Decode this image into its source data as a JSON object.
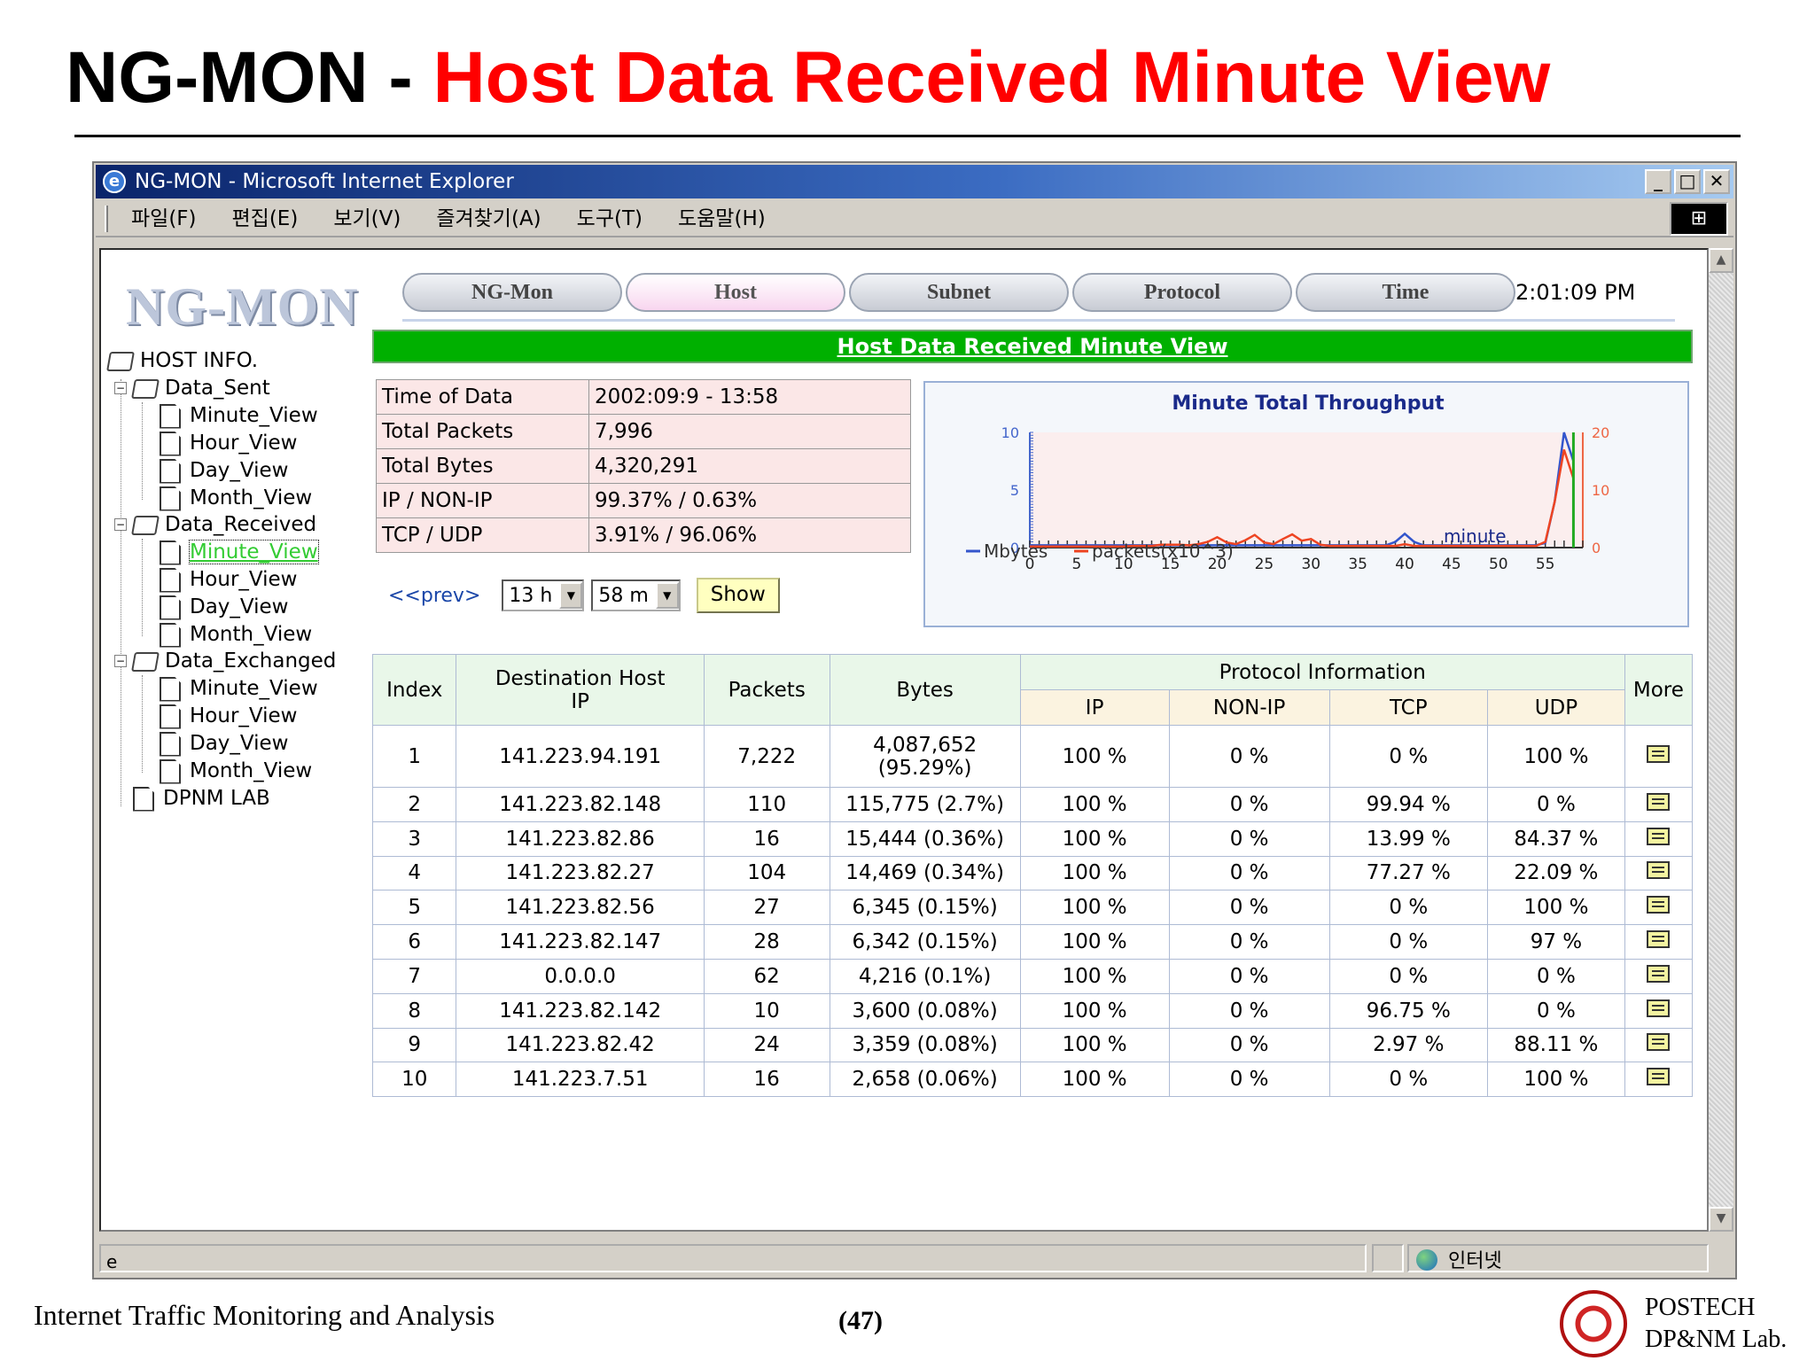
{
  "slide": {
    "title_prefix": "NG-MON - ",
    "title_main": "Host Data Received Minute View",
    "footer_left": "Internet Traffic Monitoring and Analysis",
    "page_number": "(47)",
    "org_line1": "POSTECH",
    "org_line2": "DP&NM Lab."
  },
  "browser": {
    "title": "NG-MON - Microsoft Internet Explorer",
    "menu": [
      "파일(F)",
      "편집(E)",
      "보기(V)",
      "즐겨찾기(A)",
      "도구(T)",
      "도움말(H)"
    ],
    "status_zone": "인터넷"
  },
  "app": {
    "logo": "NG-MON",
    "tabs": [
      "NG-Mon",
      "Host",
      "Subnet",
      "Protocol",
      "Time"
    ],
    "active_tab": "Host",
    "clock": "2:01:09 PM",
    "banner": "Host Data Received Minute View"
  },
  "tree": {
    "root": "HOST INFO.",
    "groups": [
      {
        "label": "Data_Sent",
        "items": [
          "Minute_View",
          "Hour_View",
          "Day_View",
          "Month_View"
        ]
      },
      {
        "label": "Data_Received",
        "items": [
          "Minute_View",
          "Hour_View",
          "Day_View",
          "Month_View"
        ]
      },
      {
        "label": "Data_Exchanged",
        "items": [
          "Minute_View",
          "Hour_View",
          "Day_View",
          "Month_View"
        ]
      }
    ],
    "leaf": "DPNM LAB",
    "selected": "Data_Received/Minute_View"
  },
  "summary": [
    {
      "label": "Time of Data",
      "value": "2002:09:9 - 13:58"
    },
    {
      "label": "Total Packets",
      "value": "7,996"
    },
    {
      "label": "Total Bytes",
      "value": "4,320,291"
    },
    {
      "label": "IP / NON-IP",
      "value": "99.37% / 0.63%"
    },
    {
      "label": "TCP / UDP",
      "value": "3.91% / 96.06%"
    }
  ],
  "controls": {
    "prev": "<<prev>",
    "hour": "13 h",
    "minute": "58 m",
    "show": "Show"
  },
  "chart_data": {
    "type": "line",
    "title": "Minute Total Throughput",
    "xlabel": "minute",
    "x_ticks": [
      0,
      5,
      10,
      15,
      20,
      25,
      30,
      35,
      40,
      45,
      50,
      55
    ],
    "left_ticks": [
      0,
      5,
      10
    ],
    "right_ticks": [
      0,
      10,
      20
    ],
    "xlim": [
      0,
      59
    ],
    "ylim_left": [
      0,
      10
    ],
    "ylim_right": [
      0,
      20
    ],
    "x": [
      0,
      1,
      2,
      3,
      4,
      5,
      6,
      7,
      8,
      9,
      10,
      11,
      12,
      13,
      14,
      15,
      16,
      17,
      18,
      19,
      20,
      21,
      22,
      23,
      24,
      25,
      26,
      27,
      28,
      29,
      30,
      31,
      32,
      33,
      34,
      35,
      36,
      37,
      38,
      39,
      40,
      41,
      42,
      43,
      44,
      45,
      46,
      47,
      48,
      49,
      50,
      51,
      52,
      53,
      54,
      55,
      56,
      57,
      58
    ],
    "series": [
      {
        "name": "Mbytes",
        "axis": "left",
        "color": "#3355cc",
        "values": [
          0.2,
          0.2,
          0.2,
          0.2,
          0.2,
          0.2,
          0.2,
          0.2,
          0.2,
          0.2,
          0.2,
          0.2,
          0.2,
          0.2,
          0.2,
          0.2,
          0.2,
          0.2,
          0.2,
          0.2,
          0.2,
          0.2,
          0.2,
          0.2,
          0.2,
          0.2,
          0.2,
          0.2,
          0.2,
          0.2,
          0.2,
          0.2,
          0.2,
          0.2,
          0.2,
          0.2,
          0.2,
          0.2,
          0.2,
          0.5,
          1.2,
          0.5,
          0.2,
          0.2,
          0.2,
          0.2,
          0.2,
          0.2,
          0.2,
          0.2,
          0.2,
          0.2,
          0.2,
          0.2,
          0.2,
          0.4,
          4.0,
          10.0,
          7.5
        ]
      },
      {
        "name": "packets(x10^3)",
        "axis": "right",
        "color": "#ee4422",
        "values": [
          0.2,
          0.2,
          0.2,
          0.2,
          0.2,
          0.2,
          0.2,
          0.2,
          0.2,
          0.2,
          0.2,
          0.3,
          0.3,
          0.3,
          0.5,
          0.5,
          0.5,
          0.4,
          0.6,
          1.0,
          1.8,
          0.9,
          0.6,
          1.3,
          2.2,
          0.9,
          0.6,
          1.5,
          2.3,
          1.2,
          1.5,
          0.5,
          0.3,
          0.3,
          0.3,
          0.3,
          0.3,
          0.3,
          0.3,
          0.3,
          0.6,
          0.3,
          0.3,
          0.3,
          0.3,
          0.3,
          0.3,
          0.3,
          0.3,
          0.3,
          0.3,
          0.3,
          0.3,
          0.3,
          0.3,
          1.0,
          8.0,
          17.0,
          12.0
        ]
      }
    ],
    "legend": [
      "Mbytes",
      "packets(x10^3)"
    ],
    "legend_position": "bottom-left"
  },
  "table": {
    "headers": {
      "index": "Index",
      "dest": "Destination Host IP",
      "packets": "Packets",
      "bytes": "Bytes",
      "protocol": "Protocol Information",
      "ip": "IP",
      "nonip": "NON-IP",
      "tcp": "TCP",
      "udp": "UDP",
      "more": "More"
    },
    "rows": [
      {
        "index": "1",
        "host": "141.223.94.191",
        "packets": "7,222",
        "bytes": "4,087,652",
        "bytes_pct": "(95.29%)",
        "ip": "100 %",
        "nonip": "0 %",
        "tcp": "0 %",
        "udp": "100 %"
      },
      {
        "index": "2",
        "host": "141.223.82.148",
        "packets": "110",
        "bytes": "115,775 (2.7%)",
        "ip": "100 %",
        "nonip": "0 %",
        "tcp": "99.94 %",
        "udp": "0 %"
      },
      {
        "index": "3",
        "host": "141.223.82.86",
        "packets": "16",
        "bytes": "15,444 (0.36%)",
        "ip": "100 %",
        "nonip": "0 %",
        "tcp": "13.99 %",
        "udp": "84.37 %"
      },
      {
        "index": "4",
        "host": "141.223.82.27",
        "packets": "104",
        "bytes": "14,469 (0.34%)",
        "ip": "100 %",
        "nonip": "0 %",
        "tcp": "77.27 %",
        "udp": "22.09 %"
      },
      {
        "index": "5",
        "host": "141.223.82.56",
        "packets": "27",
        "bytes": "6,345 (0.15%)",
        "ip": "100 %",
        "nonip": "0 %",
        "tcp": "0 %",
        "udp": "100 %"
      },
      {
        "index": "6",
        "host": "141.223.82.147",
        "packets": "28",
        "bytes": "6,342 (0.15%)",
        "ip": "100 %",
        "nonip": "0 %",
        "tcp": "0 %",
        "udp": "97 %"
      },
      {
        "index": "7",
        "host": "0.0.0.0",
        "packets": "62",
        "bytes": "4,216 (0.1%)",
        "ip": "100 %",
        "nonip": "0 %",
        "tcp": "0 %",
        "udp": "0 %"
      },
      {
        "index": "8",
        "host": "141.223.82.142",
        "packets": "10",
        "bytes": "3,600 (0.08%)",
        "ip": "100 %",
        "nonip": "0 %",
        "tcp": "96.75 %",
        "udp": "0 %"
      },
      {
        "index": "9",
        "host": "141.223.82.42",
        "packets": "24",
        "bytes": "3,359 (0.08%)",
        "ip": "100 %",
        "nonip": "0 %",
        "tcp": "2.97 %",
        "udp": "88.11 %"
      },
      {
        "index": "10",
        "host": "141.223.7.51",
        "packets": "16",
        "bytes": "2,658 (0.06%)",
        "ip": "100 %",
        "nonip": "0 %",
        "tcp": "0 %",
        "udp": "100 %"
      }
    ]
  }
}
